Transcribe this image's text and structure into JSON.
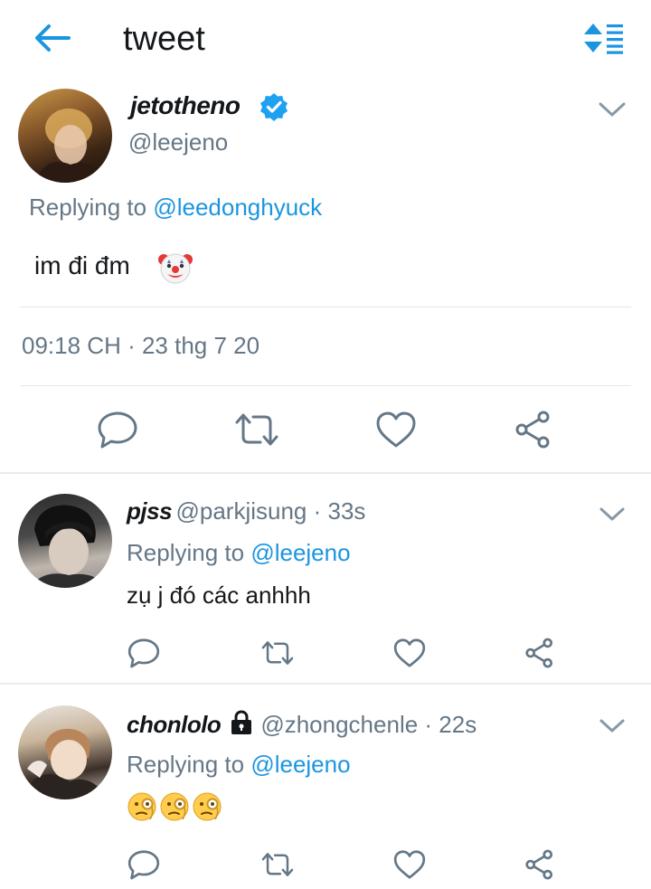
{
  "header": {
    "title": "tweet",
    "back_icon": "back-arrow-icon",
    "sort_icon": "sort-icon"
  },
  "colors": {
    "accent": "#1b95e0",
    "secondary_text": "#657786",
    "divider": "#e1e8ed"
  },
  "main_tweet": {
    "display_name": "jetotheno",
    "verified": true,
    "handle": "@leejeno",
    "replying_prefix": "Replying to ",
    "replying_to": "@leedonghyuck",
    "text": "im đi đm",
    "emoji": "clown-face",
    "timestamp": "09:18 CH · 23 thg 7 20"
  },
  "replies": [
    {
      "display_name": "pjss",
      "handle": "@parkjisung",
      "time": " · 33s",
      "replying_prefix": "Replying to ",
      "replying_to": "@leejeno",
      "text": "zụ j đó các anhhh"
    },
    {
      "display_name": "chonlolo",
      "locked": true,
      "handle": "@zhongchenle",
      "time": " · 22s",
      "replying_prefix": "Replying to ",
      "replying_to": "@leejeno",
      "emojis": [
        "face-with-monocle",
        "face-with-monocle",
        "face-with-monocle"
      ]
    }
  ]
}
